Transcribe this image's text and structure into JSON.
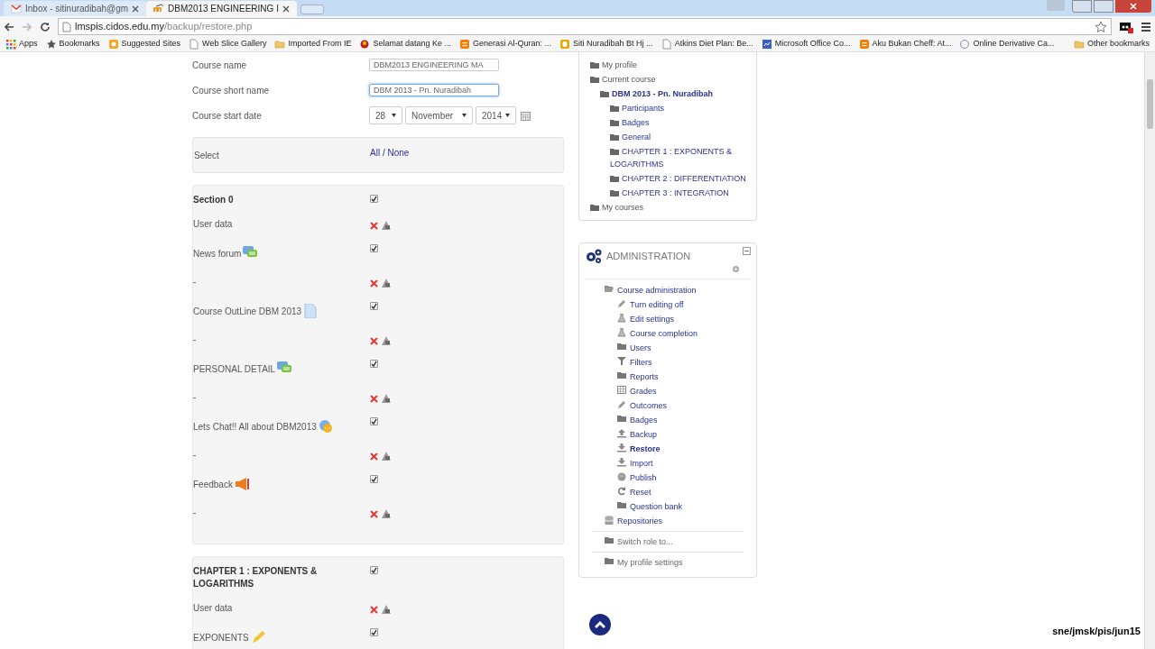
{
  "browser": {
    "tabs": [
      {
        "title": "Inbox - sitinuradibah@gm",
        "kind": "mail",
        "selected": false
      },
      {
        "title": "DBM2013 ENGINEERING I",
        "kind": "moodle",
        "selected": true
      }
    ],
    "url": {
      "host": "lmspis.cidos.edu.my",
      "path": "/backup/restore.php"
    },
    "bookmarks": [
      {
        "label": "Apps",
        "kind": "apps"
      },
      {
        "label": "Bookmarks",
        "kind": "star"
      },
      {
        "label": "Suggested Sites",
        "kind": "orange"
      },
      {
        "label": "Web Slice Gallery",
        "kind": "page"
      },
      {
        "label": "Imported From IE",
        "kind": "folder"
      },
      {
        "label": "Selamat datang Ke ...",
        "kind": "red"
      },
      {
        "label": "Generasi Al-Quran: ...",
        "kind": "blogger"
      },
      {
        "label": "Siti Nuradibah Bt Hj ...",
        "kind": "yellow"
      },
      {
        "label": "Atkins Diet Plan: Be...",
        "kind": "page"
      },
      {
        "label": "Microsoft Office Co...",
        "kind": "blue"
      },
      {
        "label": "Aku Bukan Cheff: At...",
        "kind": "blogger"
      },
      {
        "label": "Online Derivative Ca...",
        "kind": "circle"
      }
    ],
    "other_bookmarks": "Other bookmarks"
  },
  "form": {
    "fields": [
      {
        "label": "Course name",
        "value": "DBM2013 ENGINEERING MA",
        "focused": false
      },
      {
        "label": "Course short name",
        "value": "DBM 2013 - Pn. Nuradibah",
        "focused": true
      }
    ],
    "start_date": {
      "label": "Course start date",
      "day": "28",
      "month": "November",
      "year": "2014"
    },
    "select": {
      "label": "Select",
      "all": "All",
      "separator": " / ",
      "none": "None"
    }
  },
  "sections": [
    {
      "title": "Section 0",
      "checked": true,
      "rows": [
        {
          "kind": "userdata",
          "label": "User data"
        },
        {
          "kind": "forum",
          "label": "News forum",
          "checked": true
        },
        {
          "kind": "userdata",
          "label": "-"
        },
        {
          "kind": "file",
          "label": "Course OutLine DBM 2013",
          "checked": true
        },
        {
          "kind": "userdata",
          "label": "-"
        },
        {
          "kind": "forum",
          "label": "PERSONAL DETAIL",
          "checked": true
        },
        {
          "kind": "userdata",
          "label": "-"
        },
        {
          "kind": "chat",
          "label": "Lets Chat!! All about DBM2013",
          "checked": true
        },
        {
          "kind": "userdata",
          "label": "-"
        },
        {
          "kind": "megaphone",
          "label": "Feedback",
          "checked": true
        },
        {
          "kind": "userdata",
          "label": "-"
        }
      ]
    },
    {
      "title": "CHAPTER 1 : EXPONENTS & LOGARITHMS",
      "checked": true,
      "rows": [
        {
          "kind": "userdata",
          "label": "User data"
        },
        {
          "kind": "pencil",
          "label": "EXPONENTS",
          "checked": true
        }
      ]
    }
  ],
  "navigation": [
    {
      "label": "My profile"
    },
    {
      "label": "Current course",
      "children": [
        {
          "label": "DBM 2013 - Pn. Nuradibah",
          "current": true,
          "children": [
            {
              "label": "Participants"
            },
            {
              "label": "Badges"
            },
            {
              "label": "General"
            },
            {
              "label": "CHAPTER 1 : EXPONENTS & LOGARITHMS"
            },
            {
              "label": "CHAPTER 2 : DIFFERENTIATION"
            },
            {
              "label": "CHAPTER 3 : INTEGRATION"
            }
          ]
        }
      ]
    },
    {
      "label": "My courses"
    }
  ],
  "administration": {
    "title": "ADMINISTRATION",
    "items": [
      {
        "label": "Course administration",
        "kind": "folder-open",
        "children": [
          {
            "label": "Turn editing off",
            "kind": "pencil"
          },
          {
            "label": "Edit settings",
            "kind": "flask"
          },
          {
            "label": "Course completion",
            "kind": "flask"
          },
          {
            "label": "Users",
            "kind": "folder"
          },
          {
            "label": "Filters",
            "kind": "filter"
          },
          {
            "label": "Reports",
            "kind": "folder"
          },
          {
            "label": "Grades",
            "kind": "grid"
          },
          {
            "label": "Outcomes",
            "kind": "pencil"
          },
          {
            "label": "Badges",
            "kind": "folder"
          },
          {
            "label": "Backup",
            "kind": "upload"
          },
          {
            "label": "Restore",
            "kind": "download",
            "current": true
          },
          {
            "label": "Import",
            "kind": "download"
          },
          {
            "label": "Publish",
            "kind": "globe"
          },
          {
            "label": "Reset",
            "kind": "reset"
          },
          {
            "label": "Question bank",
            "kind": "folder"
          }
        ]
      },
      {
        "label": "Repositories",
        "kind": "database"
      },
      {
        "label": "Switch role to...",
        "kind": "folder",
        "divider": true,
        "muted": true
      },
      {
        "label": "My profile settings",
        "kind": "folder",
        "divider": true,
        "muted": true
      }
    ]
  },
  "overlay_caption": "sne/jmsk/pis/jun15"
}
